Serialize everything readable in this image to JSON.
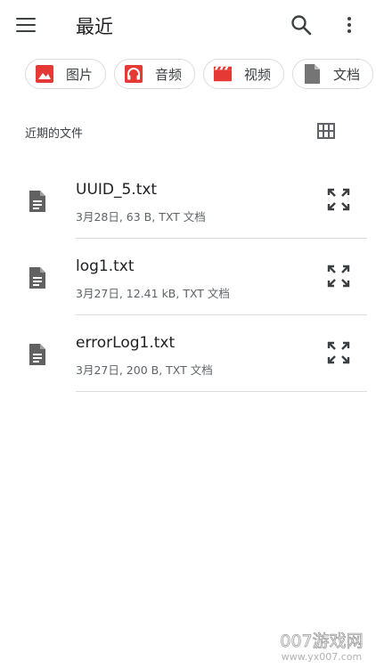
{
  "appbar": {
    "title": "最近",
    "icons": {
      "menu": "menu-icon",
      "search": "search-icon",
      "more": "more-vert-icon"
    }
  },
  "chips": [
    {
      "label": "图片",
      "icon": "image-icon",
      "color": "#e53935"
    },
    {
      "label": "音频",
      "icon": "headphones-icon",
      "color": "#e53935"
    },
    {
      "label": "视频",
      "icon": "movie-icon",
      "color": "#e53935"
    },
    {
      "label": "文档",
      "icon": "document-icon",
      "color": "#757575"
    }
  ],
  "section": {
    "title": "近期的文件",
    "view_toggle_icon": "grid-view-icon"
  },
  "files": [
    {
      "name": "UUID_5.txt",
      "meta": "3月28日, 63 B, TXT 文档"
    },
    {
      "name": "log1.txt",
      "meta": "3月27日, 12.41 kB, TXT 文档"
    },
    {
      "name": "errorLog1.txt",
      "meta": "3月27日, 200 B, TXT 文档"
    }
  ],
  "watermark": {
    "line1": "007游戏网",
    "line2": "www.yx007.com"
  },
  "colors": {
    "accent_red": "#e53935",
    "icon_gray": "#616161",
    "divider": "#dadce0",
    "text_primary": "#202124",
    "text_secondary": "#5f6368"
  }
}
